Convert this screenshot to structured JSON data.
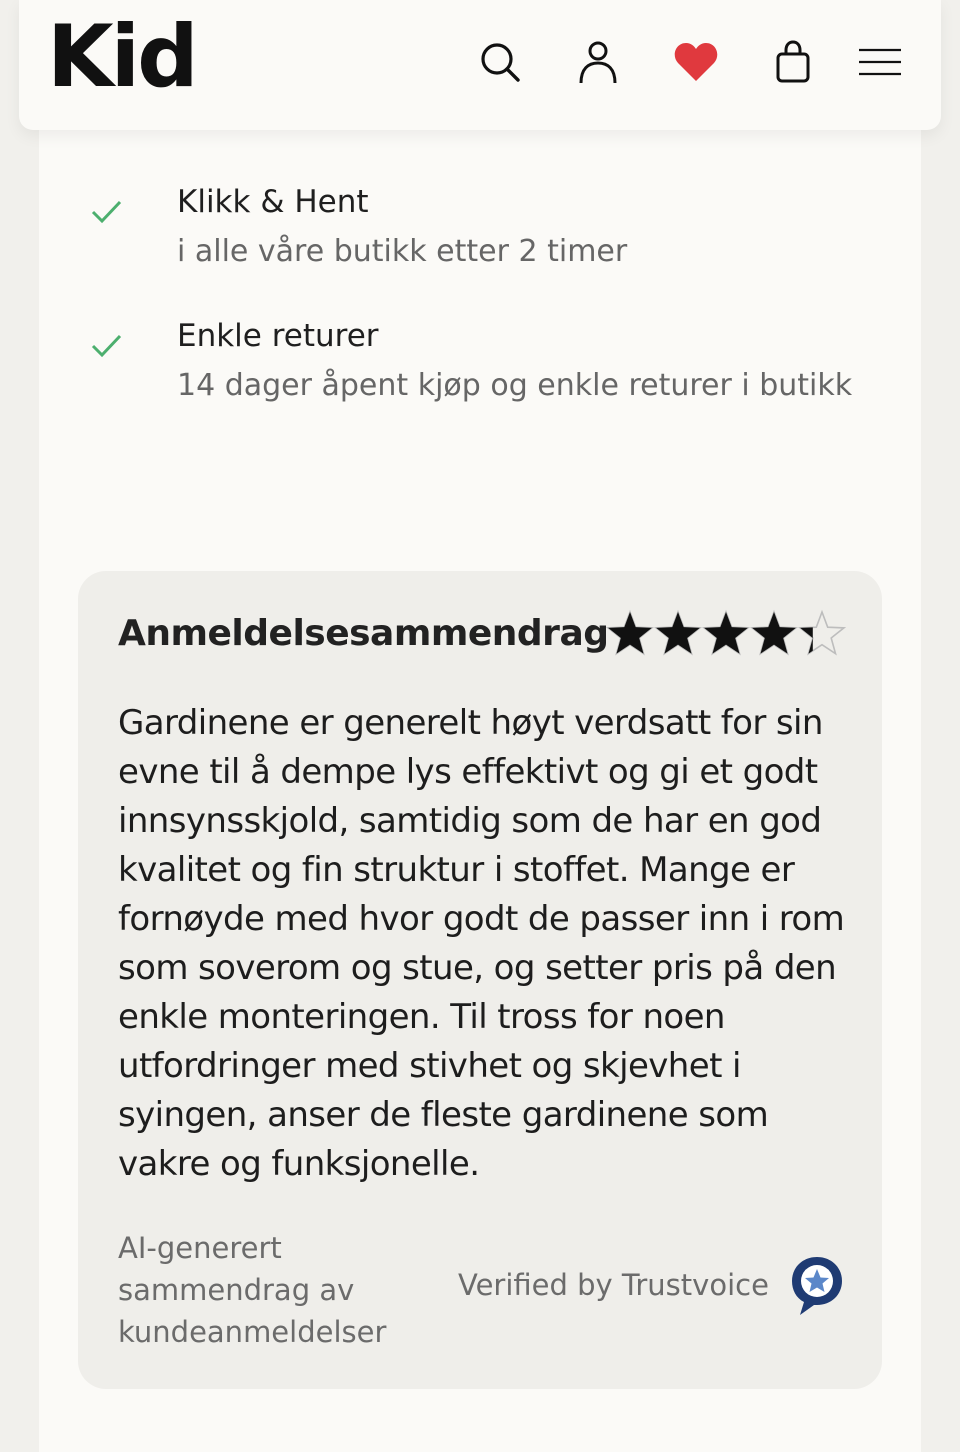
{
  "header": {
    "logo": "Kid",
    "icons": {
      "search": "search-icon",
      "account": "user-icon",
      "wishlist": "heart-icon",
      "cart": "bag-icon",
      "menu": "menu-icon"
    },
    "heart_color": "#e0393e"
  },
  "usps": [
    {
      "title": "Klikk & Hent",
      "subtitle": "i alle våre butikk etter 2 timer"
    },
    {
      "title": "Enkle returer",
      "subtitle": "14 dager åpent kjøp og enkle returer i butikk"
    }
  ],
  "review_summary": {
    "title": "Anmeldelsesammendrag",
    "rating": 4.3,
    "rating_max": 5,
    "text": "Gardinene er generelt høyt verdsatt for sin evne til å dempe lys effektivt og gi et godt innsynsskjold, samtidig som de har en god kvalitet og fin struktur i stoffet. Mange er fornøyde med hvor godt de passer inn i rom som soverom og stue, og setter pris på den enkle monteringen. Til tross for noen utfordringer med stivhet og skjevhet i syingen, anser de fleste gardinene som vakre og funksjonelle.",
    "ai_note": "AI-generert sammendrag av kundeanmeldelser",
    "verified": "Verified by Trustvoice",
    "check_color": "#4caf6e",
    "trustvoice_color": "#1f3b73"
  }
}
